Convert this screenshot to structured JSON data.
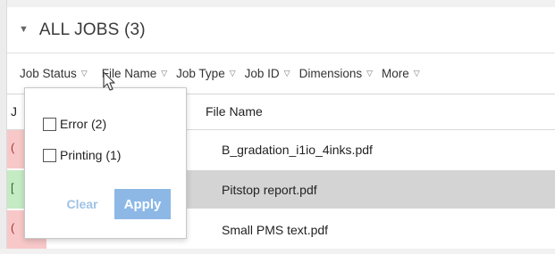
{
  "section": {
    "caret": "▼",
    "title": "ALL JOBS (3)"
  },
  "filters": [
    {
      "label": "Job Status"
    },
    {
      "label": "File Name"
    },
    {
      "label": "Job Type"
    },
    {
      "label": "Job ID"
    },
    {
      "label": "Dimensions"
    },
    {
      "label": "More"
    }
  ],
  "filter_chevron": "▽",
  "columns": {
    "status": "J",
    "file_name": "File Name"
  },
  "rows": [
    {
      "status_char": "(",
      "file": "B_gradation_i1io_4inks.pdf",
      "status": "error"
    },
    {
      "status_char": "[",
      "file": "Pitstop report.pdf",
      "status": "printing"
    },
    {
      "status_char": "(",
      "file": "Small PMS text.pdf",
      "status": "error"
    }
  ],
  "popup": {
    "options": [
      {
        "label": "Error (2)",
        "checked": false
      },
      {
        "label": "Printing (1)",
        "checked": false
      }
    ],
    "clear": "Clear",
    "apply": "Apply"
  },
  "colors": {
    "error": "#f8c8c8",
    "printing": "#c5ebc5",
    "selected_row": "#d4d4d4",
    "apply_button": "#8db8e6",
    "clear_text": "#9ec2e6"
  }
}
